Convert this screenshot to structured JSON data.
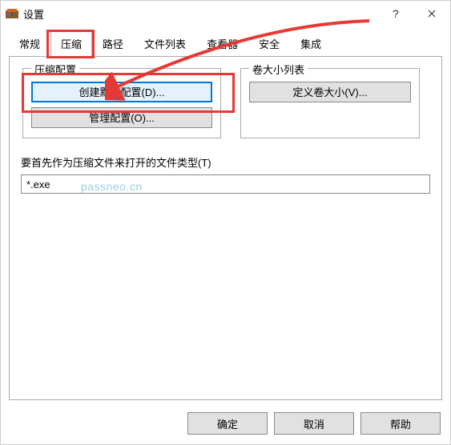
{
  "titlebar": {
    "title": "设置"
  },
  "tabs": {
    "general": "常规",
    "compression": "压缩",
    "path": "路径",
    "filelist": "文件列表",
    "viewer": "查看器",
    "security": "安全",
    "integration": "集成"
  },
  "groups": {
    "left_legend": "压缩配置",
    "right_legend": "卷大小列表",
    "create_default": "创建默认配置(D)...",
    "manage": "管理配置(O)...",
    "define_vol": "定义卷大小(V)..."
  },
  "file_section": {
    "label": "要首先作为压缩文件来打开的文件类型(T)",
    "value": "*.exe"
  },
  "footer": {
    "ok": "确定",
    "cancel": "取消",
    "help": "帮助"
  },
  "watermark": "passneo.cn"
}
